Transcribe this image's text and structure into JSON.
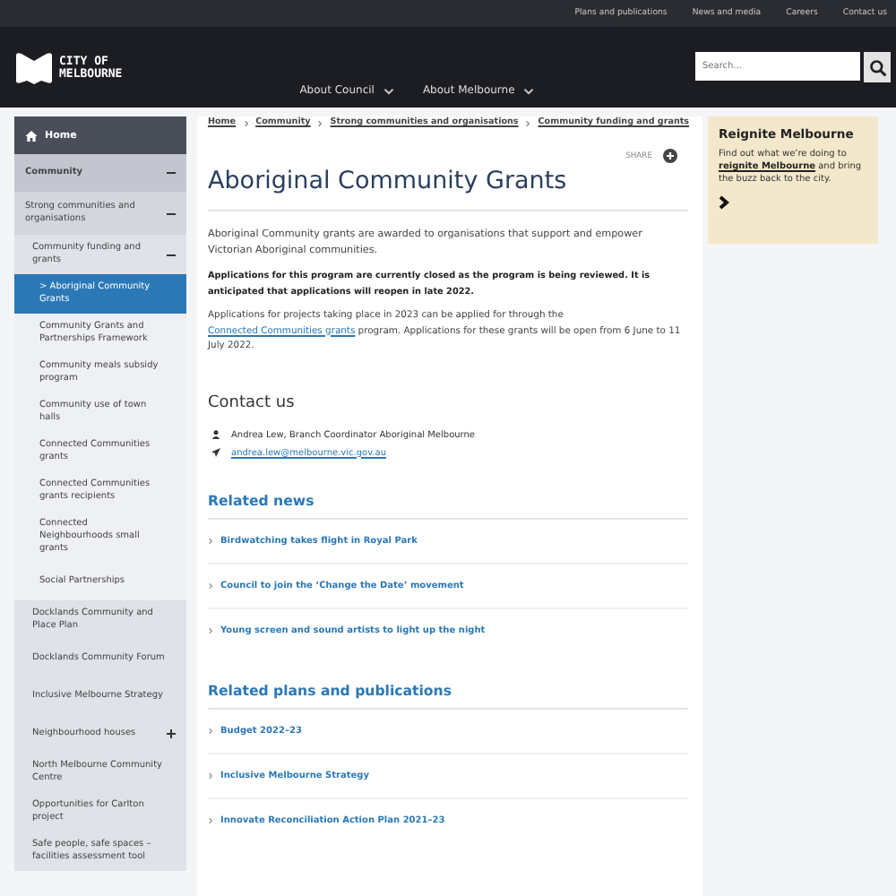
{
  "top_links": [
    "Plans and publications",
    "News and media",
    "Careers",
    "Contact us"
  ],
  "logo": {
    "line1": "CITY OF",
    "line2": "MELBOURNE"
  },
  "nav": [
    {
      "label": "About Council",
      "expanded": false
    },
    {
      "label": "About Melbourne",
      "expanded": false
    }
  ],
  "search": {
    "placeholder": "Search..."
  },
  "sidebar": {
    "home": "Home",
    "items": [
      {
        "label": "Community",
        "selected": false,
        "expanded": true,
        "children": [
          {
            "label": "Strong communities and organisations",
            "selected": false,
            "expanded": true,
            "children": [
              {
                "label": "Community funding and grants",
                "selected": false,
                "expanded": true,
                "children": [
                  {
                    "label": "> Aboriginal Community Grants",
                    "selected": true
                  },
                  {
                    "label": "Community Grants and Partnerships Framework",
                    "selected": false
                  },
                  {
                    "label": "Community meals subsidy program",
                    "selected": false
                  },
                  {
                    "label": "Community use of town halls",
                    "selected": false
                  },
                  {
                    "label": "Connected Communities grants",
                    "selected": false
                  },
                  {
                    "label": "Connected Communities grants recipients",
                    "selected": false
                  },
                  {
                    "label": "Connected Neighbourhoods small grants",
                    "selected": false
                  },
                  {
                    "label": "Social Partnerships",
                    "selected": false
                  }
                ]
              },
              {
                "label": "Docklands Community and Place Plan",
                "selected": false
              },
              {
                "label": "Docklands Community Forum",
                "selected": false
              },
              {
                "label": "Inclusive Melbourne Strategy",
                "selected": false
              },
              {
                "label": "Neighbourhood houses",
                "selected": false,
                "expanded": false
              },
              {
                "label": "North Melbourne Community Centre",
                "selected": false
              },
              {
                "label": "Opportunities for Carlton project",
                "selected": false
              },
              {
                "label": "Safe people, safe spaces – facilities assessment tool",
                "selected": false
              }
            ]
          }
        ]
      }
    ]
  },
  "breadcrumb": [
    "Home",
    "Community",
    "Strong communities and organisations",
    "Community funding and grants"
  ],
  "share": "SHARE",
  "title": "Aboriginal Community Grants",
  "intro": "Aboriginal Community grants are awarded to organisations that support and empower Victorian Aboriginal communities.",
  "notice": "Applications for this program are currently closed as the program is being reviewed. It is anticipated that applications will reopen in late 2022.",
  "para": {
    "before": "Applications for projects taking place in 2023 can be applied for through the ",
    "link": "Connected Communities grants",
    "after": " program. Applications for these grants will be open from 6 June to 11 July 2022."
  },
  "contact": {
    "heading": "Contact us",
    "name": "Andrea Lew, Branch Coordinator Aboriginal Melbourne",
    "email": "andrea.lew@melbourne.vic.gov.au"
  },
  "sections": [
    {
      "heading": "Related news",
      "items": [
        "Birdwatching takes flight in Royal Park",
        "Council to join the ‘Change the Date’ movement",
        "Young screen and sound artists to light up the night"
      ]
    },
    {
      "heading": "Related plans and publications",
      "items": [
        "Budget 2022–23",
        "Inclusive Melbourne Strategy",
        "Innovate Reconciliation Action Plan 2021–23"
      ]
    }
  ],
  "promo": {
    "title": "Reignite Melbourne",
    "before": "Find out what we’re doing to ",
    "link": "reignite Melbourne",
    "after": " and bring the buzz back to the city."
  }
}
